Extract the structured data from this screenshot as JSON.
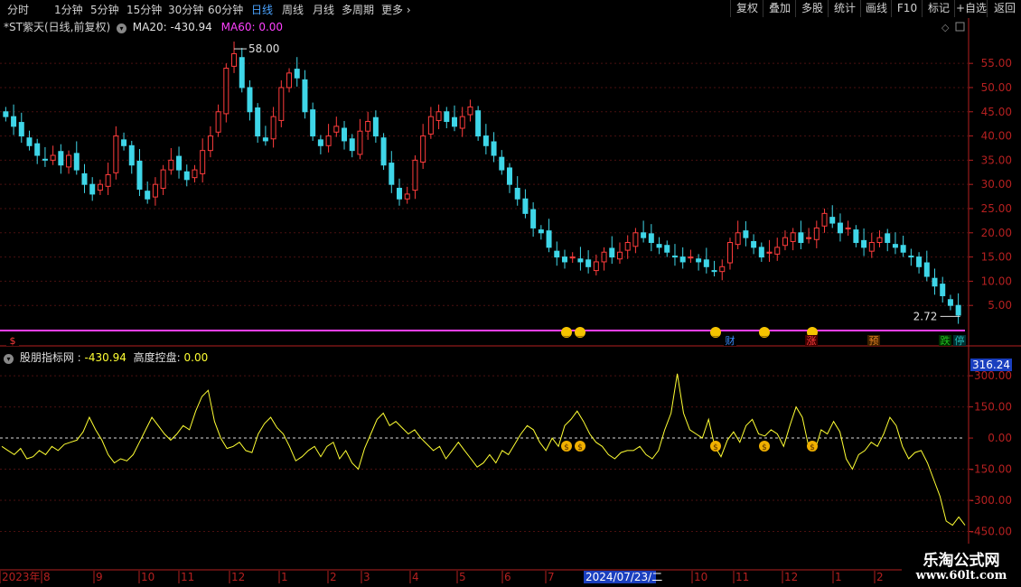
{
  "toolbar": {
    "periods": [
      "分时",
      "1分钟",
      "5分钟",
      "15分钟",
      "30分钟",
      "60分钟",
      "日线",
      "周线",
      "月线",
      "多周期",
      "更多"
    ],
    "active_period": "日线",
    "right_buttons": [
      "复权",
      "叠加",
      "多股",
      "统计",
      "画线",
      "F10",
      "标记",
      "+自选",
      "返回"
    ]
  },
  "main_header": {
    "title": "*ST紫天(日线,前复权)",
    "ma20_label": "MA20: -430.94",
    "ma60_label": "MA60: 0.00"
  },
  "indicator_header": {
    "name": "股朋指标网 :",
    "value": "-430.94",
    "sub_name": "高度控盘:",
    "sub_value": "0.00"
  },
  "colors": {
    "up": "#ff3c3c",
    "down": "#3fd6e8",
    "ma60": "#ff40ff",
    "indicator": "#ffff33",
    "axis_red": "#b52020",
    "highlight": "#1a3fbf"
  },
  "chart_data": [
    {
      "type": "candlestick",
      "y_ticks": [
        "55.00",
        "50.00",
        "45.00",
        "40.00",
        "35.00",
        "30.00",
        "25.00",
        "20.00",
        "15.00",
        "10.00",
        "5.00"
      ],
      "ylim": [
        0,
        61
      ],
      "annotations": [
        {
          "text": "58.00"
        },
        {
          "text": "2.72"
        }
      ],
      "series": [
        {
          "name": "close",
          "values": [
            44,
            42,
            40,
            38,
            36,
            35,
            36,
            34,
            36,
            33,
            30,
            28,
            30,
            32,
            40,
            38,
            34,
            29,
            27,
            30,
            33,
            35,
            33,
            31,
            33,
            37,
            40,
            45,
            54,
            57,
            50,
            45,
            40,
            39,
            44,
            50,
            53,
            52,
            45,
            40,
            38,
            40,
            42,
            39,
            37,
            41,
            43,
            40,
            34,
            30,
            27,
            28,
            35,
            40,
            44,
            45,
            43,
            42,
            44,
            46,
            40,
            38,
            36,
            33,
            30,
            27,
            24,
            21,
            20,
            17,
            15,
            14,
            15,
            14,
            13,
            14,
            16,
            15,
            16,
            18,
            20,
            19,
            18,
            17,
            16,
            15,
            14,
            15,
            14,
            13,
            12,
            13,
            18,
            20,
            19,
            17,
            15,
            16,
            17,
            19,
            20,
            18,
            19,
            21,
            24,
            22,
            20,
            21,
            18,
            17,
            18,
            19,
            18,
            17,
            16,
            15,
            13,
            11,
            9,
            7,
            5,
            3
          ]
        }
      ],
      "markers": {
        "smile_faces": [
          "😊",
          "😊",
          "😊",
          "😊",
          "😊"
        ],
        "tags": [
          "$",
          "财",
          "涨",
          "预",
          "跌",
          "停"
        ]
      }
    },
    {
      "type": "line",
      "y_ticks": [
        "300.00",
        "150.00",
        "0.00",
        "-150.00",
        "-300.00",
        "-450.00"
      ],
      "ylim": [
        -500,
        370
      ],
      "current_value_label": "316.24",
      "series": [
        {
          "name": "股朋指标网",
          "values": [
            -40,
            -60,
            -80,
            -50,
            -100,
            -90,
            -60,
            -80,
            -40,
            -60,
            -30,
            -20,
            -10,
            30,
            100,
            40,
            -10,
            -80,
            -120,
            -100,
            -110,
            -80,
            -20,
            40,
            100,
            60,
            20,
            -10,
            20,
            60,
            40,
            130,
            200,
            230,
            80,
            0,
            -50,
            -40,
            -20,
            -60,
            -70,
            20,
            70,
            100,
            50,
            20,
            -40,
            -110,
            -90,
            -60,
            -40,
            -90,
            -40,
            -20,
            -100,
            -60,
            -120,
            -150,
            -50,
            20,
            90,
            120,
            60,
            80,
            50,
            20,
            40,
            0,
            -30,
            -60,
            -40,
            -100,
            -60,
            -20,
            -60,
            -100,
            -140,
            -120,
            -80,
            -120,
            -60,
            -80,
            -30,
            20,
            60,
            40,
            -20,
            -60,
            0,
            -40,
            60,
            90,
            130,
            80,
            20,
            -20,
            -40,
            -80,
            -100,
            -70,
            -60,
            -60,
            -40,
            -80,
            -100,
            -60,
            40,
            120,
            310,
            120,
            40,
            20,
            0,
            90,
            -40,
            -90,
            -10,
            30,
            -20,
            60,
            90,
            20,
            10,
            40,
            20,
            -40,
            60,
            150,
            100,
            -40,
            -60,
            40,
            20,
            80,
            30,
            -100,
            -150,
            -80,
            -60,
            -20,
            -40,
            20,
            100,
            60,
            -40,
            -100,
            -70,
            -60,
            -120,
            -200,
            -280,
            -400,
            -420,
            -380,
            -420
          ]
        }
      ],
      "money_markers": [
        "💰",
        "💰",
        "💰",
        "💰",
        "💰"
      ]
    }
  ],
  "x_axis": {
    "labels": [
      "2023年",
      "8",
      "9",
      "10",
      "11",
      "12",
      "1",
      "2",
      "3",
      "4",
      "5",
      "6",
      "7",
      "2024/07/23/二",
      "10",
      "11",
      "12",
      "1",
      "2"
    ]
  },
  "watermark": {
    "line1": "乐淘公式网",
    "line2": "www.60lt.com"
  }
}
